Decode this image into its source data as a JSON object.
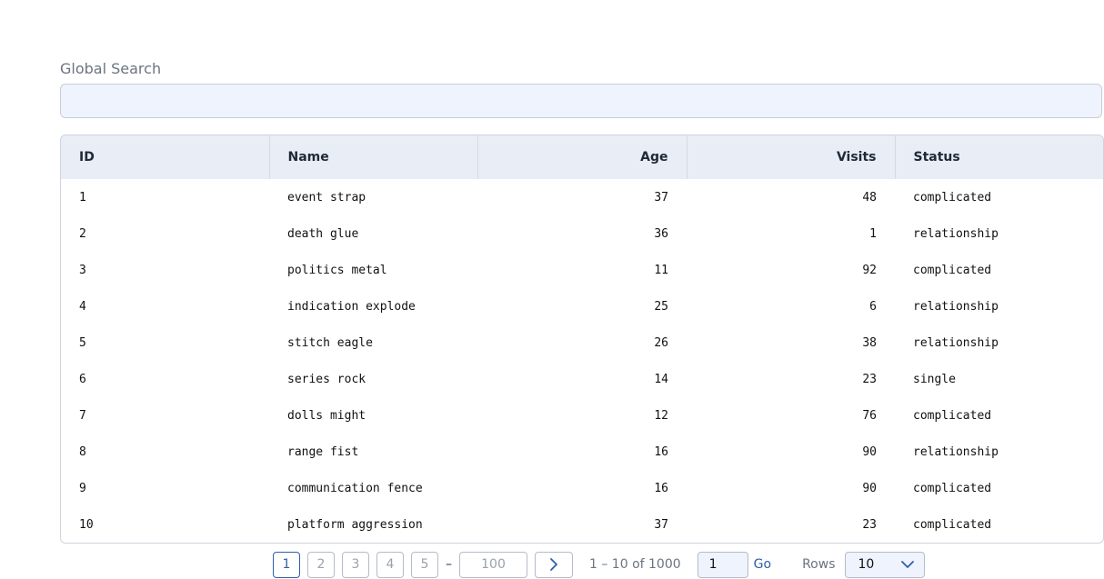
{
  "search": {
    "label": "Global Search",
    "value": "",
    "placeholder": ""
  },
  "table": {
    "columns": [
      "ID",
      "Name",
      "Age",
      "Visits",
      "Status"
    ],
    "rows": [
      [
        "1",
        "event strap",
        "37",
        "48",
        "complicated"
      ],
      [
        "2",
        "death glue",
        "36",
        "1",
        "relationship"
      ],
      [
        "3",
        "politics metal",
        "11",
        "92",
        "complicated"
      ],
      [
        "4",
        "indication explode",
        "25",
        "6",
        "relationship"
      ],
      [
        "5",
        "stitch eagle",
        "26",
        "38",
        "relationship"
      ],
      [
        "6",
        "series rock",
        "14",
        "23",
        "single"
      ],
      [
        "7",
        "dolls might",
        "12",
        "76",
        "complicated"
      ],
      [
        "8",
        "range fist",
        "16",
        "90",
        "relationship"
      ],
      [
        "9",
        "communication fence",
        "16",
        "90",
        "complicated"
      ],
      [
        "10",
        "platform aggression",
        "37",
        "23",
        "complicated"
      ]
    ]
  },
  "pagination": {
    "pages": [
      "1",
      "2",
      "3",
      "4",
      "5"
    ],
    "dash": "–",
    "last_page": "100",
    "next_icon": "chevron-right-icon",
    "range_text": "1 – 10 of 1000",
    "goto_value": "1",
    "go_label": "Go",
    "rows_label": "Rows",
    "rows_value": "10",
    "rows_icon": "chevron-down-icon",
    "accent_color": "#2f5ea8"
  }
}
